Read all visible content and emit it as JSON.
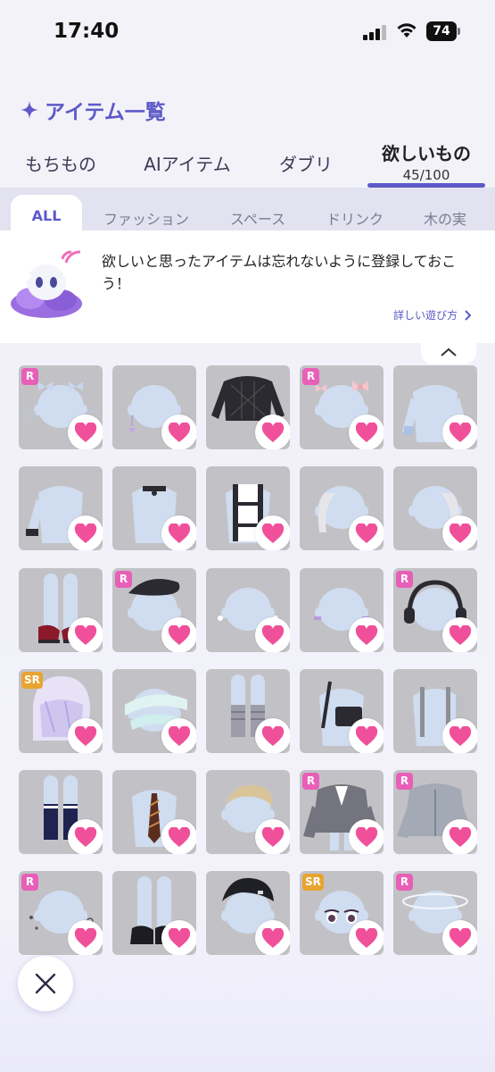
{
  "status_bar": {
    "time": "17:40",
    "battery": "74"
  },
  "header": {
    "title": "アイテム一覧",
    "icon": "sparkle-icon"
  },
  "tabs": [
    {
      "label": "もちもの"
    },
    {
      "label": "AIアイテム"
    },
    {
      "label": "ダブリ"
    },
    {
      "label": "欲しいもの",
      "count": "45/100",
      "active": true
    }
  ],
  "categories": [
    {
      "label": "ALL",
      "active": true
    },
    {
      "label": "ファッション"
    },
    {
      "label": "スペース"
    },
    {
      "label": "ドリンク"
    },
    {
      "label": "木の実"
    }
  ],
  "banner": {
    "text": "欲しいと思ったアイテムは忘れないように登録しておこう！",
    "link": "詳しい遊び方"
  },
  "items": [
    {
      "rarity": "R",
      "kind": "hair-bows"
    },
    {
      "rarity": "",
      "kind": "earring"
    },
    {
      "rarity": "",
      "kind": "black-lace-top"
    },
    {
      "rarity": "R",
      "kind": "pink-bows"
    },
    {
      "rarity": "",
      "kind": "blue-sleeve"
    },
    {
      "rarity": "",
      "kind": "cuff-bracelet"
    },
    {
      "rarity": "",
      "kind": "choker"
    },
    {
      "rarity": "",
      "kind": "tank-top"
    },
    {
      "rarity": "",
      "kind": "silver-hair-left"
    },
    {
      "rarity": "",
      "kind": "silver-hair-right"
    },
    {
      "rarity": "",
      "kind": "red-shoes"
    },
    {
      "rarity": "R",
      "kind": "black-beret"
    },
    {
      "rarity": "",
      "kind": "glasses-light"
    },
    {
      "rarity": "",
      "kind": "blush"
    },
    {
      "rarity": "R",
      "kind": "headphones"
    },
    {
      "rarity": "SR",
      "kind": "lavender-hair"
    },
    {
      "rarity": "",
      "kind": "bandage-wrap"
    },
    {
      "rarity": "",
      "kind": "gray-socks"
    },
    {
      "rarity": "",
      "kind": "shoulder-bag"
    },
    {
      "rarity": "",
      "kind": "backpack-straps"
    },
    {
      "rarity": "",
      "kind": "navy-socks"
    },
    {
      "rarity": "",
      "kind": "striped-tie"
    },
    {
      "rarity": "",
      "kind": "blonde-bangs"
    },
    {
      "rarity": "R",
      "kind": "gray-jacket"
    },
    {
      "rarity": "R",
      "kind": "gray-hoodie"
    },
    {
      "rarity": "R",
      "kind": "piercings"
    },
    {
      "rarity": "",
      "kind": "black-mary-janes"
    },
    {
      "rarity": "",
      "kind": "black-cap"
    },
    {
      "rarity": "SR",
      "kind": "eyes"
    },
    {
      "rarity": "R",
      "kind": "halo"
    }
  ],
  "colors": {
    "accent": "#5d59c8",
    "heart": "#f0509a",
    "rarity_r": "#e85fb8",
    "rarity_sr": "#e8a430",
    "cell_bg": "#c2c2c6",
    "mannequin": "#d0ddf0"
  },
  "icons": [
    "sparkle-icon",
    "chevron-right-icon",
    "chevron-up-icon",
    "heart-icon",
    "close-icon",
    "mascot-icon"
  ]
}
